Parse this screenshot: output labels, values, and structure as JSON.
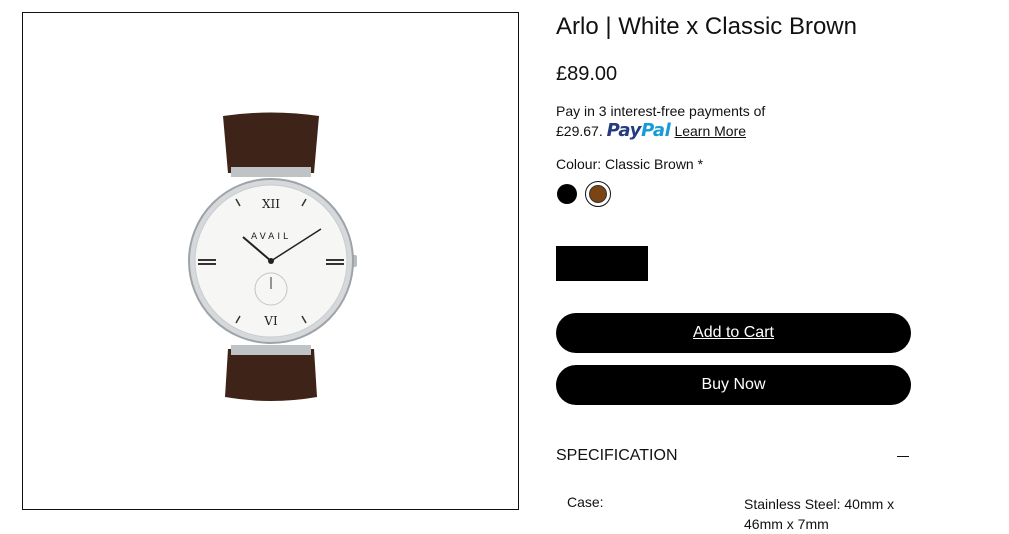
{
  "product": {
    "title": "Arlo | White x Classic Brown",
    "price": "£89.00",
    "image_alt": "Arlo watch with white dial and classic brown leather strap",
    "watch_brand_mark": "AVAIL"
  },
  "paypal": {
    "text_line1": "Pay in 3 interest-free payments of",
    "amount": "£29.67.",
    "logo_pay": "Pay",
    "logo_pal": "Pal",
    "learn_more": "Learn More"
  },
  "colour": {
    "label": "Colour: Classic Brown *",
    "options": [
      {
        "name": "Black",
        "color": "#000000",
        "selected": false
      },
      {
        "name": "Classic Brown",
        "color": "#7a4513",
        "selected": true
      }
    ]
  },
  "actions": {
    "add_to_cart": "Add to Cart",
    "buy_now": "Buy Now"
  },
  "specification": {
    "title": "SPECIFICATION",
    "rows": [
      {
        "key": "Case:",
        "value": "Stainless Steel: 40mm x 46mm x 7mm"
      }
    ]
  }
}
